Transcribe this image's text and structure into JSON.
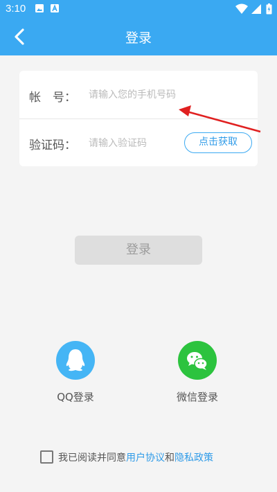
{
  "status": {
    "time": "3:10"
  },
  "header": {
    "title": "登录"
  },
  "form": {
    "account_label": "帐　号：",
    "account_placeholder": "请输入您的手机号码",
    "code_label": "验证码：",
    "code_placeholder": "请输入验证码",
    "get_code_label": "点击获取"
  },
  "login_button": "登录",
  "social": {
    "qq_label": "QQ登录",
    "wechat_label": "微信登录"
  },
  "agreement": {
    "prefix": "我已阅读并同意",
    "user_agreement": "用户协议",
    "and": "和",
    "privacy_policy": "隐私政策"
  },
  "colors": {
    "primary": "#3aa9f2",
    "qq": "#45b5f5",
    "wechat": "#2cc33e",
    "annotation_arrow": "#e02020"
  }
}
